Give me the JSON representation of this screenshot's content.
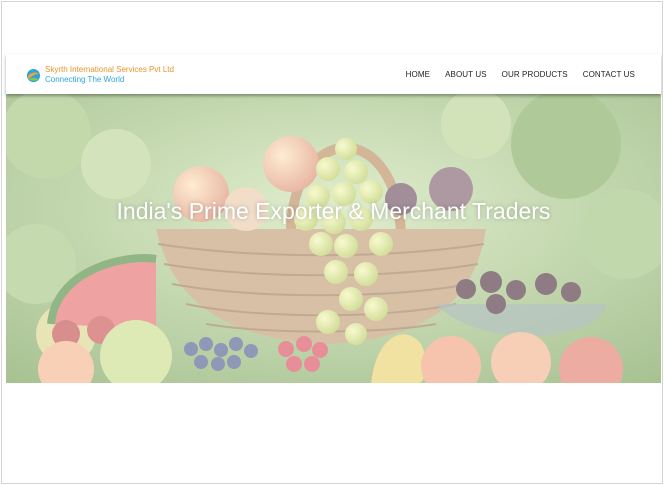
{
  "brand": {
    "name": "Skyrth International Services Pvt Ltd",
    "tagline": "Connecting The World",
    "colors": {
      "name": "#e8932a",
      "tagline": "#2fa5d6"
    }
  },
  "nav": {
    "items": [
      {
        "label": "HOME"
      },
      {
        "label": "ABOUT US"
      },
      {
        "label": "OUR PRODUCTS"
      },
      {
        "label": "CONTACT US"
      }
    ]
  },
  "hero": {
    "title": "India's Prime Exporter & Merchant Traders",
    "image": "fruit-basket-photo"
  }
}
